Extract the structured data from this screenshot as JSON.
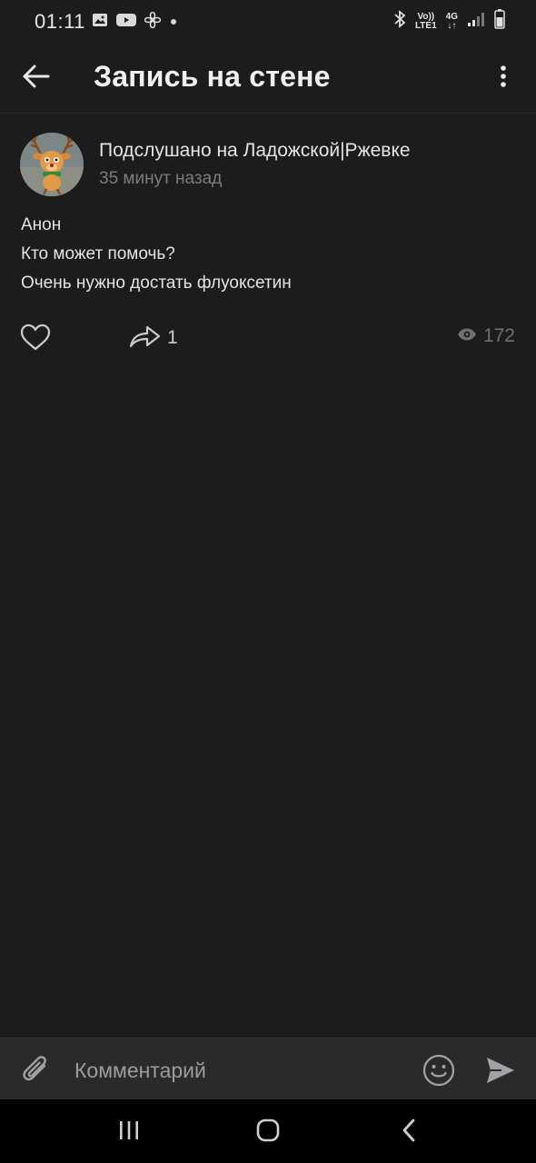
{
  "status_bar": {
    "time": "01:11",
    "left_icons": [
      "image-icon",
      "youtube-icon",
      "fan-icon",
      "dot-icon"
    ],
    "network_top": "Vo))",
    "network_bottom": "LTE1",
    "net_type": "4G",
    "right_icons": [
      "bluetooth-icon",
      "signal-icon",
      "battery-icon"
    ]
  },
  "header": {
    "title": "Запись на стене",
    "back_icon": "arrow-left-icon",
    "menu_icon": "more-vertical-icon"
  },
  "post": {
    "author": "Подслушано на Ладожской|Ржевке",
    "time": "35 минут назад",
    "lines": [
      "Анон",
      "Кто может помочь?",
      "Очень нужно достать флуоксетин"
    ],
    "shares": "1",
    "views": "172"
  },
  "comment_bar": {
    "placeholder": "Комментарий"
  },
  "colors": {
    "background": "#1c1c1c",
    "comment_bar": "#2a2a2a",
    "text": "#e1e3e6",
    "secondary_text": "#7b7d80"
  }
}
